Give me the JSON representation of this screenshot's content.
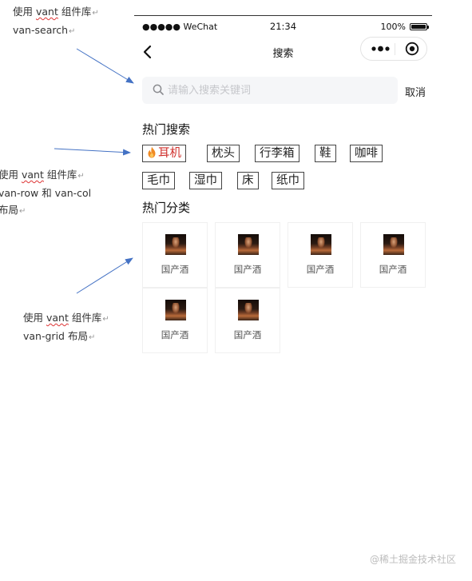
{
  "annotations": [
    {
      "lines": [
        "使用 vant 组件库",
        "van-search"
      ],
      "underline_word": "vant"
    },
    {
      "lines": [
        "使用 vant 组件库",
        "van-row  和  van-col",
        "布局"
      ],
      "underline_word": "vant"
    },
    {
      "lines": [
        "使用 vant 组件库",
        "van-grid 布局"
      ],
      "underline_word": "vant"
    }
  ],
  "status_bar": {
    "carrier": "●●●●● WeChat",
    "time": "21:34",
    "battery": "100%",
    "battery_level": 1.0
  },
  "nav_bar": {
    "title": "搜索",
    "back_icon": "chevron-left-icon",
    "menu_icon": "more-dots-icon",
    "close_icon": "target-circle-icon"
  },
  "search": {
    "placeholder": "请输入搜索关键词",
    "value": "",
    "cancel_label": "取消",
    "icon": "search-icon",
    "colors": {
      "field_bg": "#f5f6f8",
      "placeholder": "#c6c7cb"
    }
  },
  "hot_search": {
    "title": "热门搜索",
    "rows": [
      [
        "耳机",
        "枕头",
        "行李箱",
        "鞋",
        "咖啡"
      ],
      [
        "毛巾",
        "湿巾",
        "床",
        "纸巾"
      ]
    ],
    "hot_icon": "flame-icon",
    "hot_color": "#d0312d"
  },
  "hot_categories": {
    "title": "热门分类",
    "items": [
      {
        "label": "国产酒",
        "icon": "liquor-thumbnail"
      },
      {
        "label": "国产酒",
        "icon": "liquor-thumbnail"
      },
      {
        "label": "国产酒",
        "icon": "liquor-thumbnail"
      },
      {
        "label": "国产酒",
        "icon": "liquor-thumbnail"
      },
      {
        "label": "国产酒",
        "icon": "liquor-thumbnail"
      },
      {
        "label": "国产酒",
        "icon": "liquor-thumbnail"
      }
    ]
  },
  "watermark": "@稀土掘金技术社区",
  "colors": {
    "arrow": "#4472c4",
    "text": "#222222",
    "border": "#444444"
  }
}
